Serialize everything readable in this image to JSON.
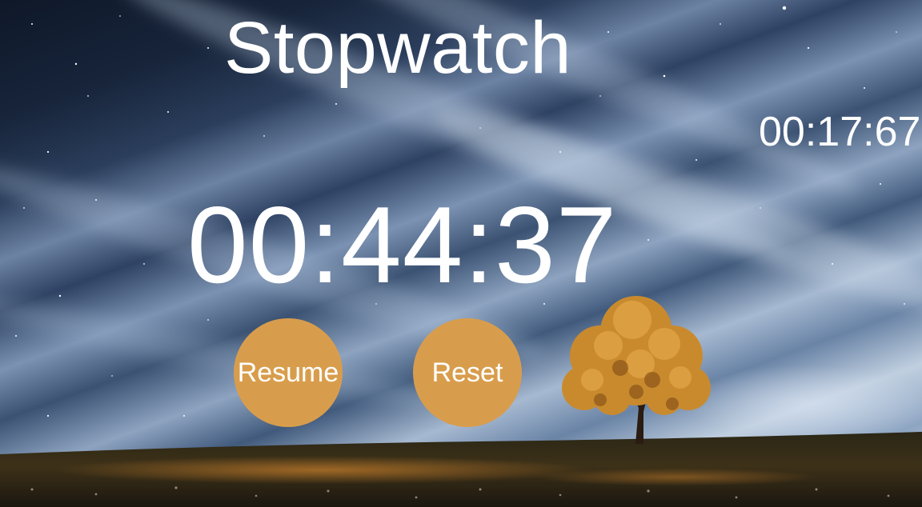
{
  "app": {
    "title": "Stopwatch",
    "lap_time": "00:17:67",
    "elapsed_time": "00:44:37"
  },
  "controls": {
    "resume_label": "Resume",
    "reset_label": "Reset"
  },
  "colors": {
    "button": "#d89d4c",
    "text": "#ffffff"
  }
}
